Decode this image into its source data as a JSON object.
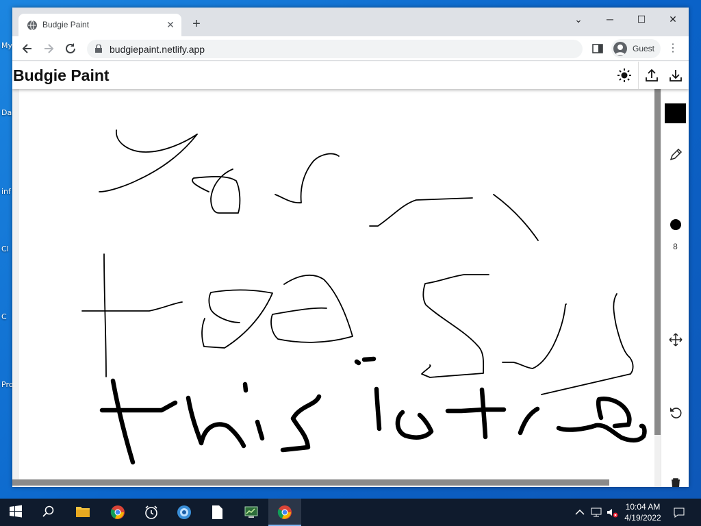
{
  "desktop": {
    "labels": [
      "My",
      "Da",
      "inf",
      "Cl",
      "C",
      "Pro"
    ]
  },
  "browser": {
    "tab_title": "Budgie Paint",
    "tab_close": "✕",
    "new_tab": "+",
    "minimize": "─",
    "maximize": "☐",
    "close": "✕",
    "tab_search": "⌄",
    "url": "budgiepaint.netlify.app",
    "profile_name": "Guest",
    "menu": "⋮"
  },
  "app": {
    "title": "Budgie Paint",
    "brush_size": "8",
    "current_color": "#000000"
  },
  "taskbar": {
    "time": "10:04 AM",
    "date": "4/19/2022"
  },
  "colors": {
    "desktop_bg": "#0a63c9",
    "taskbar_bg": "#0f1b2d",
    "tab_strip": "#dee1e6",
    "scrollbar": "#8a8a8a"
  }
}
